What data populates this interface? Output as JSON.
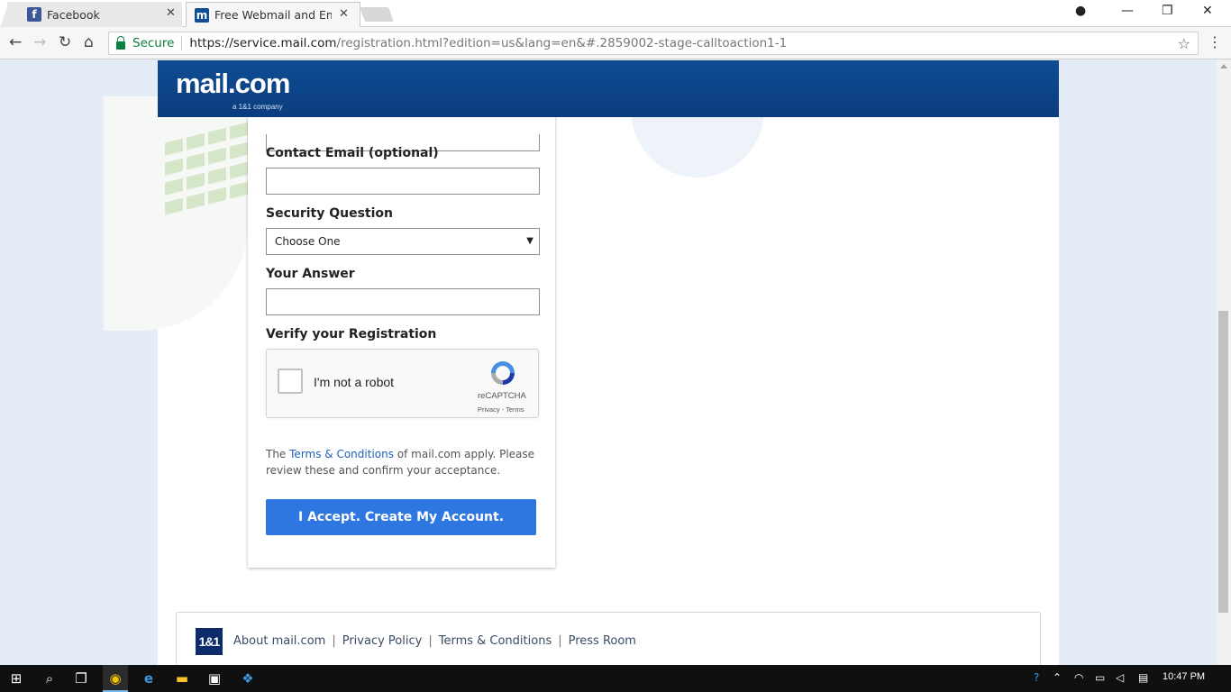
{
  "browser": {
    "tabs": [
      {
        "title": "Facebook",
        "favicon": "facebook-icon",
        "active": false
      },
      {
        "title": "Free Webmail and Email",
        "favicon": "mailcom-icon",
        "active": true
      }
    ],
    "secure_label": "Secure",
    "url_host": "https://service.mail.com",
    "url_rest": "/registration.html?edition=us&lang=en&#.2859002-stage-calltoaction1-1"
  },
  "header": {
    "logo_text": "mail.com",
    "logo_sub": "a 1&1 company"
  },
  "form": {
    "contact_email_label": "Contact Email (optional)",
    "contact_email_value": "",
    "security_question_label": "Security Question",
    "security_question_selected": "Choose One",
    "answer_label": "Your Answer",
    "answer_value": "",
    "verify_label": "Verify your Registration",
    "recaptcha": {
      "label": "I'm not a robot",
      "brand": "reCAPTCHA",
      "links": "Privacy - Terms"
    },
    "terms_prefix": "The ",
    "terms_link": "Terms & Conditions",
    "terms_suffix": " of mail.com apply. Please review these and confirm your acceptance.",
    "accept_button": "I Accept. Create My Account."
  },
  "footer": {
    "logo": "1&1",
    "links": [
      "About mail.com",
      "Privacy Policy",
      "Terms & Conditions",
      "Press Room"
    ]
  },
  "taskbar": {
    "time": "10:47 PM"
  },
  "colors": {
    "header_blue": "#0f4c93",
    "accent_button": "#2f77e0",
    "link": "#2160b8",
    "secure_green": "#0b8043"
  }
}
